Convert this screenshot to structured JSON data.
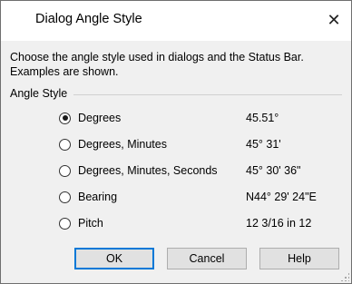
{
  "window": {
    "title": "Dialog Angle Style",
    "close_glyph": "✕"
  },
  "description": "Choose the angle style used in dialogs and the Status Bar. Examples are shown.",
  "group": {
    "label": "Angle Style"
  },
  "options": [
    {
      "label": "Degrees",
      "example": "45.51°",
      "checked": true
    },
    {
      "label": "Degrees, Minutes",
      "example": "45° 31'",
      "checked": false
    },
    {
      "label": "Degrees, Minutes, Seconds",
      "example": "45° 30' 36\"",
      "checked": false
    },
    {
      "label": "Bearing",
      "example": "N44° 29' 24\"E",
      "checked": false
    },
    {
      "label": "Pitch",
      "example": "12 3/16 in 12",
      "checked": false
    }
  ],
  "buttons": {
    "ok": "OK",
    "cancel": "Cancel",
    "help": "Help"
  },
  "colors": {
    "default_button_border": "#0078d7",
    "dialog_bg": "#f0f0f0"
  }
}
